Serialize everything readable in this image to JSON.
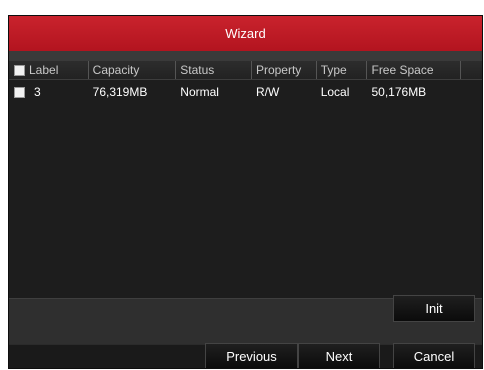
{
  "window": {
    "title": "Wizard"
  },
  "table": {
    "columns": [
      "Label",
      "Capacity",
      "Status",
      "Property",
      "Type",
      "Free Space"
    ],
    "rows": [
      {
        "label": "3",
        "capacity": "76,319MB",
        "status": "Normal",
        "property": "R/W",
        "type": "Local",
        "free_space": "50,176MB"
      }
    ]
  },
  "buttons": {
    "init": "Init",
    "previous": "Previous",
    "next": "Next",
    "cancel": "Cancel"
  },
  "colors": {
    "title_bar": "#c11d27",
    "background": "#1d1d1d"
  }
}
